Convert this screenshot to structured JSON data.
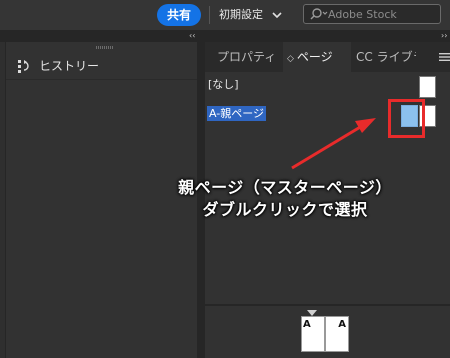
{
  "topbar": {
    "share_label": "共有",
    "workspace_label": "初期設定",
    "workspace_chevron_icon": "chevron-down-icon",
    "search": {
      "placeholder": "Adobe Stock",
      "icon": "search-icon",
      "value": ""
    }
  },
  "collapse": {
    "left_glyph": "‹‹",
    "right_glyph": "››"
  },
  "history_panel": {
    "label": "ヒストリー",
    "icon": "history-icon"
  },
  "pages_panel": {
    "tabs": [
      {
        "label": "プロパティ"
      },
      {
        "label": "ページ",
        "arrows": "◇",
        "active": true
      },
      {
        "label": "CC ライブラ"
      }
    ],
    "menu_icon": "panel-menu-icon",
    "masters": [
      {
        "label": "[なし]"
      },
      {
        "label": "A-親ページ",
        "selected": true
      }
    ],
    "spread": {
      "left_label": "A",
      "right_label": "A"
    }
  },
  "annotation": {
    "line1": "親ページ（マスターページ）",
    "line2": "ダブルクリックで選択",
    "color": "#e82b2b"
  },
  "colors": {
    "accent": "#1473e6",
    "selection": "#2f66c2",
    "master_thumb": "#8cc1ee",
    "annotation": "#e82b2b"
  }
}
